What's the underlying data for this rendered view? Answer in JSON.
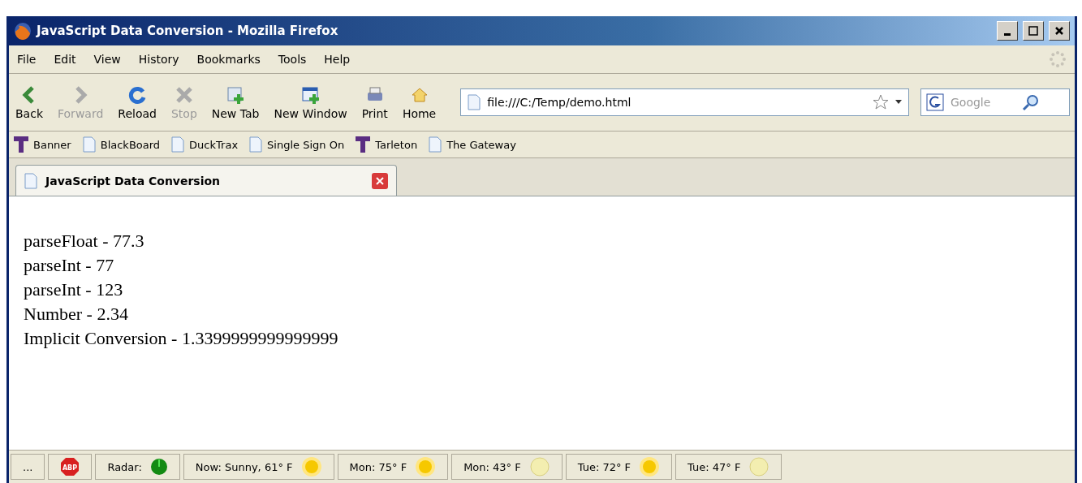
{
  "window": {
    "title": "JavaScript Data Conversion - Mozilla Firefox"
  },
  "menu": [
    "File",
    "Edit",
    "View",
    "History",
    "Bookmarks",
    "Tools",
    "Help"
  ],
  "toolbar": [
    {
      "kind": "back",
      "label": "Back",
      "disabled": false
    },
    {
      "kind": "forward",
      "label": "Forward",
      "disabled": true
    },
    {
      "kind": "reload",
      "label": "Reload",
      "disabled": false
    },
    {
      "kind": "stop",
      "label": "Stop",
      "disabled": true
    },
    {
      "kind": "newtab",
      "label": "New Tab",
      "disabled": false
    },
    {
      "kind": "newwindow",
      "label": "New Window",
      "disabled": false
    },
    {
      "kind": "print",
      "label": "Print",
      "disabled": false
    },
    {
      "kind": "home",
      "label": "Home",
      "disabled": false
    }
  ],
  "address": {
    "value": "file:///C:/Temp/demo.html"
  },
  "search": {
    "placeholder": "Google"
  },
  "bookmarks": [
    {
      "kind": "t",
      "label": "Banner"
    },
    {
      "kind": "page",
      "label": "BlackBoard"
    },
    {
      "kind": "page",
      "label": "DuckTrax"
    },
    {
      "kind": "page",
      "label": "Single Sign On"
    },
    {
      "kind": "t",
      "label": "Tarleton"
    },
    {
      "kind": "page",
      "label": "The Gateway"
    }
  ],
  "tabs": [
    {
      "label": "JavaScript Data Conversion",
      "selected": true
    }
  ],
  "content": [
    "parseFloat - 77.3",
    "parseInt - 77",
    "parseInt - 123",
    "Number - 2.34",
    "Implicit Conversion - 1.3399999999999999"
  ],
  "status_bar": [
    {
      "kind": "text",
      "label": "..."
    },
    {
      "kind": "abp",
      "label": "ABP"
    },
    {
      "kind": "radar",
      "label": "Radar:"
    },
    {
      "kind": "sun",
      "label": "Now: Sunny, 61° F"
    },
    {
      "kind": "sun",
      "label": "Mon: 75° F"
    },
    {
      "kind": "moon",
      "label": "Mon: 43° F"
    },
    {
      "kind": "sun",
      "label": "Tue: 72° F"
    },
    {
      "kind": "moon",
      "label": "Tue: 47° F"
    }
  ]
}
